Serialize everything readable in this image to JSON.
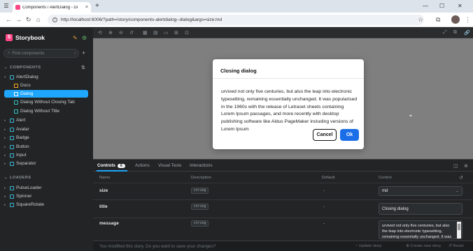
{
  "browser": {
    "tab_title": "Components / AlertDialog - Di",
    "tab_close": "×",
    "new_tab": "+",
    "window_controls": [
      "—",
      "☐",
      "✕"
    ],
    "url": "http://localhost:6006/?path=/story/components-alertdialog--dialog&args=size:md",
    "nav": [
      "←",
      "→",
      "↻",
      "⌂"
    ],
    "menu_icon": "☰"
  },
  "sidebar": {
    "brand": "Storybook",
    "logo_letter": "S",
    "search_placeholder": "Find components",
    "search_shortcut": "/",
    "plus": "+",
    "sections": [
      {
        "label": "COMPONENTS"
      },
      {
        "label": "LOADERS"
      }
    ],
    "components": [
      {
        "label": "AlertDialog",
        "type": "component",
        "expanded": true
      },
      {
        "label": "Docs",
        "type": "doc"
      },
      {
        "label": "Dialog",
        "type": "story",
        "active": true
      },
      {
        "label": "Dialog Without Closing Tab",
        "type": "story"
      },
      {
        "label": "Dialog Without Title",
        "type": "story"
      },
      {
        "label": "Alert",
        "type": "component"
      },
      {
        "label": "Avatar",
        "type": "component"
      },
      {
        "label": "Badge",
        "type": "component"
      },
      {
        "label": "Button",
        "type": "component"
      },
      {
        "label": "Input",
        "type": "component"
      },
      {
        "label": "Separator",
        "type": "component"
      }
    ],
    "loaders": [
      {
        "label": "PulseLoader",
        "type": "component"
      },
      {
        "label": "Spinner",
        "type": "component"
      },
      {
        "label": "SquareRotate",
        "type": "component"
      }
    ]
  },
  "dialog": {
    "title": "Closing dialog",
    "message": "urvived not only five centuries, but also the leap into electronic typesetting, remaining essentially unchanged. It was popularised in the 1960s with the release of Letraset sheets containing Lorem Ipsum passages, and more recently with desktop publishing software like Aldus PageMaker including versions of Lorem Ipsum",
    "cancel_label": "Cancel",
    "ok_label": "Ok"
  },
  "panel": {
    "tabs": [
      {
        "label": "Controls",
        "count": "6",
        "active": true
      },
      {
        "label": "Actions"
      },
      {
        "label": "Visual Tests"
      },
      {
        "label": "Interactions"
      }
    ],
    "columns": [
      "Name",
      "Description",
      "Default",
      "Control"
    ],
    "rows": [
      {
        "name": "size",
        "type": "string",
        "default": "-",
        "control": "md",
        "control_kind": "select"
      },
      {
        "name": "title",
        "type": "string",
        "default": "-",
        "control": "Closing dialog",
        "control_kind": "textarea"
      },
      {
        "name": "message",
        "type": "string",
        "default": "-",
        "control": "urvived not only five centuries, but also the leap into electronic typesetting, remaining essentially unchanged. It was",
        "control_kind": "textarea"
      }
    ],
    "save_message": "You modified this story. Do you want to save your changes?",
    "update_story": "Update story",
    "create_story": "Create new story",
    "reset": "Reset"
  },
  "colors": {
    "accent": "#1ea7fd",
    "brand": "#ff4785",
    "ok_button": "#1a6fe8",
    "canvas_bg": "#7f7f7f"
  }
}
